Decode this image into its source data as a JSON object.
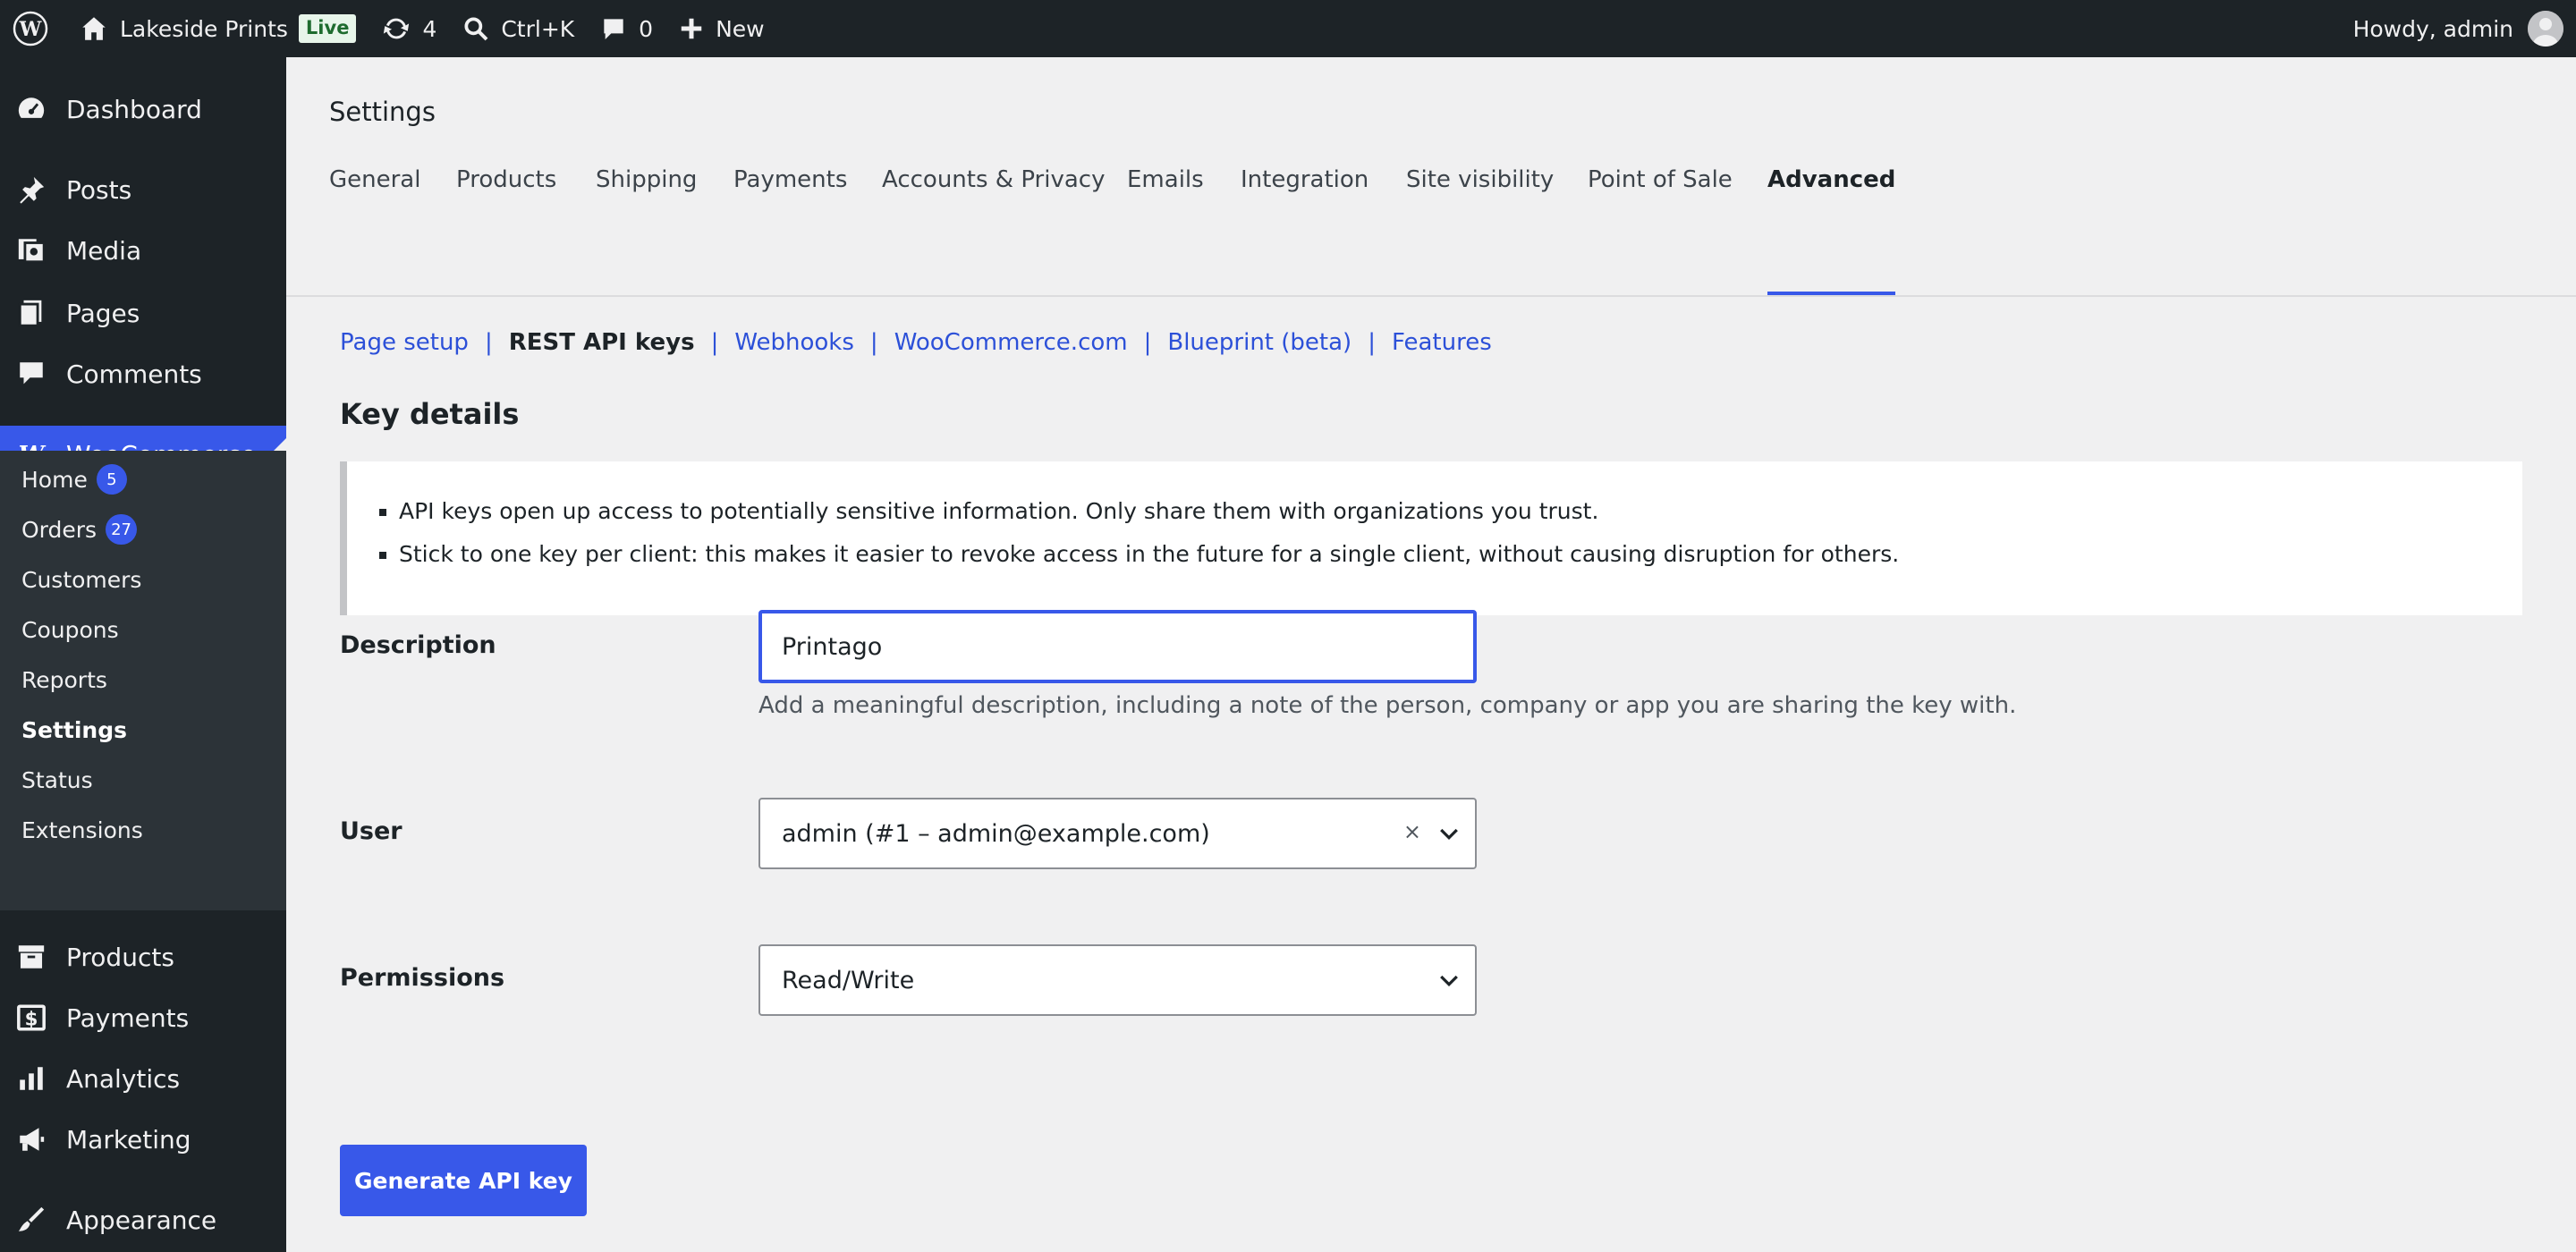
{
  "adminbar": {
    "site_name": "Lakeside Prints",
    "live_label": "Live",
    "updates_count": "4",
    "search_shortcut": "Ctrl+K",
    "comments_count": "0",
    "new_label": "New",
    "howdy": "Howdy, admin"
  },
  "sidebar": {
    "dashboard": "Dashboard",
    "posts": "Posts",
    "media": "Media",
    "pages": "Pages",
    "comments": "Comments",
    "woocommerce": "WooCommerce",
    "submenu": {
      "home": "Home",
      "home_badge": "5",
      "orders": "Orders",
      "orders_badge": "27",
      "customers": "Customers",
      "coupons": "Coupons",
      "reports": "Reports",
      "settings": "Settings",
      "status": "Status",
      "extensions": "Extensions"
    },
    "products": "Products",
    "payments": "Payments",
    "analytics": "Analytics",
    "marketing": "Marketing",
    "appearance": "Appearance"
  },
  "main": {
    "page_title": "Settings",
    "tabs": [
      "General",
      "Products",
      "Shipping",
      "Payments",
      "Accounts & Privacy",
      "Emails",
      "Integration",
      "Site visibility",
      "Point of Sale",
      "Advanced"
    ],
    "subnav": {
      "page_setup": "Page setup",
      "rest_api": "REST API keys",
      "webhooks": "Webhooks",
      "woocommerce_com": "WooCommerce.com",
      "blueprint": "Blueprint (beta)",
      "features": "Features",
      "separator": "|"
    },
    "section_title": "Key details",
    "notice": [
      "API keys open up access to potentially sensitive information. Only share them with organizations you trust.",
      "Stick to one key per client: this makes it easier to revoke access in the future for a single client, without causing disruption for others."
    ],
    "description_label": "Description",
    "description_value": "Printago",
    "description_help": "Add a meaningful description, including a note of the person, company or app you are sharing the key with.",
    "user_label": "User",
    "user_value": "admin (#1 – admin@example.com)",
    "user_clear": "×",
    "permissions_label": "Permissions",
    "permissions_value": "Read/Write",
    "generate_button": "Generate API key"
  },
  "colors": {
    "accent": "#3858e9",
    "adminbar_bg": "#1d2327",
    "submenu_bg": "#2c3338",
    "link": "#2c50d8"
  }
}
